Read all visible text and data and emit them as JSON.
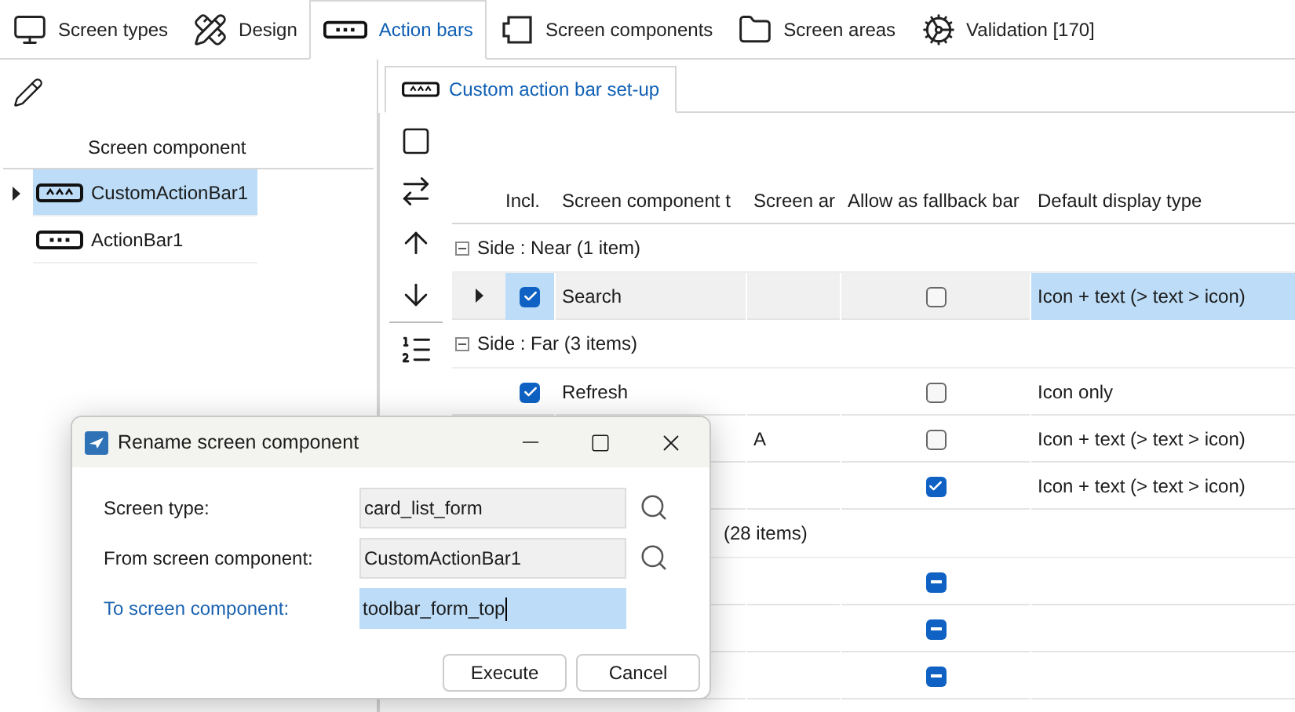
{
  "tabs": [
    {
      "label": "Screen types",
      "selected": false
    },
    {
      "label": "Design",
      "selected": false
    },
    {
      "label": "Action bars",
      "selected": true
    },
    {
      "label": "Screen components",
      "selected": false
    },
    {
      "label": "Screen areas",
      "selected": false
    },
    {
      "label": "Validation [170]",
      "selected": false
    }
  ],
  "left_panel": {
    "column": "Screen component",
    "items": [
      {
        "label": "CustomActionBar1",
        "kind": "custom",
        "expandable": true,
        "selected": true
      },
      {
        "label": "ActionBar1",
        "kind": "plain",
        "expandable": false,
        "selected": false
      }
    ]
  },
  "sub_tab": {
    "label": "Custom action bar set-up",
    "selected": true
  },
  "table": {
    "columns": [
      "Incl.",
      "Screen component t",
      "Screen ar",
      "Allow as fallback bar",
      "Default display type"
    ],
    "rows": [
      {
        "kind": "group",
        "label": "Side : Near (1 item)"
      },
      {
        "kind": "item",
        "expandable": true,
        "included": true,
        "name": "Search",
        "fallback": false,
        "display": "Icon + text (> text > icon)",
        "selected": true
      },
      {
        "kind": "group",
        "label": "Side : Far (3 items)"
      },
      {
        "kind": "item",
        "expandable": false,
        "included": true,
        "name": "Refresh",
        "fallback": false,
        "display": "Icon only",
        "selected": false
      },
      {
        "kind": "item",
        "area": "A",
        "fallback": false,
        "display": "Icon + text (> text > icon)",
        "selected": false
      },
      {
        "kind": "item",
        "fallback": true,
        "display": "Icon + text (> text > icon)",
        "selected": false
      },
      {
        "kind": "group_tail",
        "label": "(28 items)"
      },
      {
        "kind": "item",
        "fallback_mixed": true,
        "selected": false
      },
      {
        "kind": "item",
        "fallback_mixed": true,
        "selected": false
      },
      {
        "kind": "item",
        "fallback_mixed": true,
        "selected": false
      }
    ]
  },
  "dialog": {
    "title": "Rename screen component",
    "fields": [
      {
        "label": "Screen type:",
        "value": "card_list_form",
        "searchable": true,
        "focused": false
      },
      {
        "label": "From screen component:",
        "value": "CustomActionBar1",
        "searchable": true,
        "focused": false
      },
      {
        "label": "To screen component:",
        "value": "toolbar_form_top",
        "searchable": false,
        "focused": true
      }
    ],
    "buttons": [
      "Execute",
      "Cancel"
    ]
  }
}
